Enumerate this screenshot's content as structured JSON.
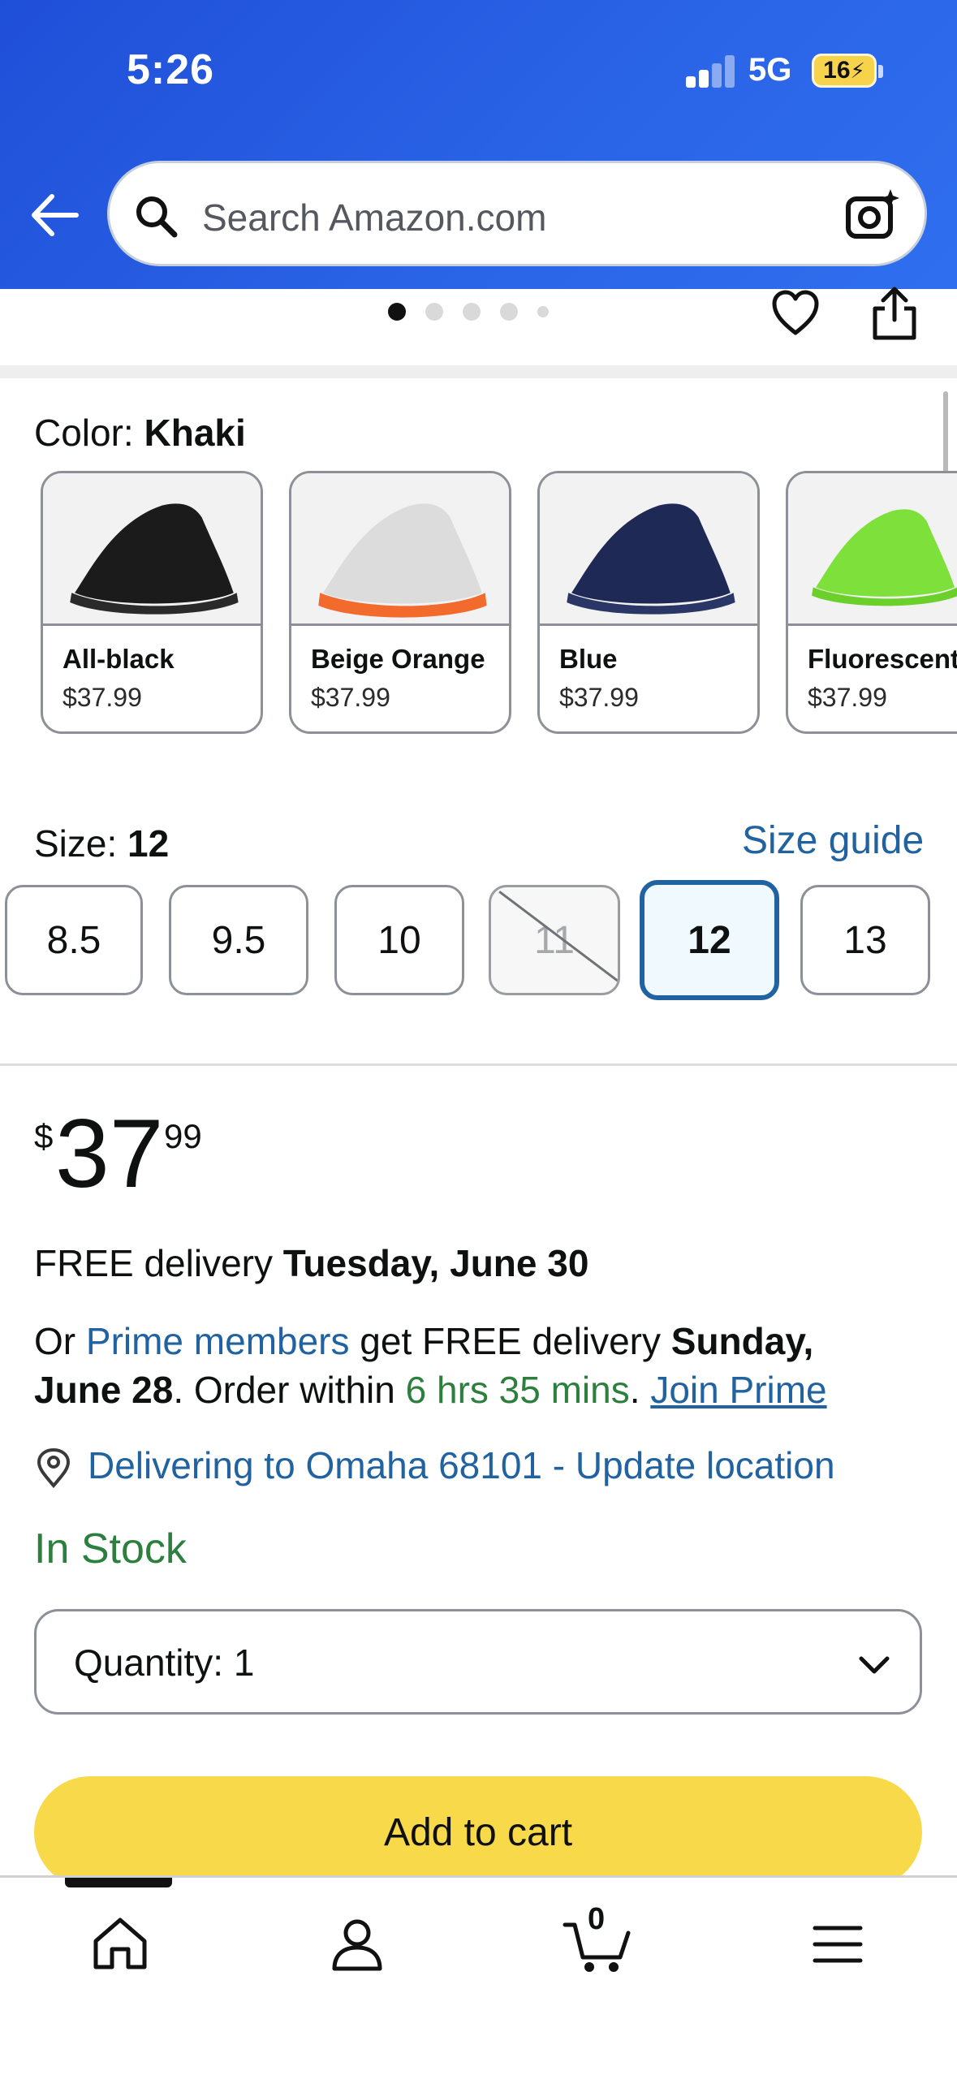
{
  "status_bar": {
    "time": "5:26",
    "network": "5G",
    "battery": "16"
  },
  "search": {
    "placeholder": "Search Amazon.com"
  },
  "gallery": {
    "dot_count": 5,
    "active_index": 0
  },
  "color": {
    "label": "Color:",
    "selected": "Khaki",
    "options": [
      {
        "name": "All-black",
        "price": "$37.99",
        "shoe_color": "#1b1b1b",
        "sole_color": "#2a2a2a"
      },
      {
        "name": "Beige Orange",
        "price": "$37.99",
        "shoe_color": "#dcdcdc",
        "sole_color": "#f26a2c"
      },
      {
        "name": "Blue",
        "price": "$37.99",
        "shoe_color": "#1e2a55",
        "sole_color": "#2a3666"
      },
      {
        "name": "Fluorescent",
        "price": "$37.99",
        "shoe_color": "#7ee03a",
        "sole_color": "#6bd12a"
      }
    ]
  },
  "size": {
    "label": "Size:",
    "selected": "12",
    "guide_link": "Size guide",
    "options": [
      {
        "value": "8.5",
        "state": "available"
      },
      {
        "value": "9.5",
        "state": "available"
      },
      {
        "value": "10",
        "state": "available"
      },
      {
        "value": "11",
        "state": "unavailable"
      },
      {
        "value": "12",
        "state": "selected"
      },
      {
        "value": "13",
        "state": "available"
      }
    ]
  },
  "price": {
    "symbol": "$",
    "whole": "37",
    "fraction": "99"
  },
  "delivery": {
    "free_prefix": "FREE delivery ",
    "free_date": "Tuesday, June 30",
    "prime_or": "Or ",
    "prime_members": "Prime members",
    "prime_mid": " get FREE delivery ",
    "prime_date_part1": "Sunday,",
    "prime_date_part2": "June 28",
    "order_within_prefix": ". Order within ",
    "order_within_time": "6 hrs 35 mins",
    "period": ". ",
    "join_prime": "Join Prime",
    "location": "Delivering to Omaha 68101 - Update location"
  },
  "stock": "In Stock",
  "quantity": {
    "label": "Quantity:",
    "value": "1"
  },
  "add_to_cart": "Add to cart",
  "bottom_nav": {
    "cart_count": "0"
  },
  "colors": {
    "header_blue": "#2a63e6",
    "link_blue": "#2162a1",
    "stock_green": "#2d7f3e",
    "cart_yellow": "#f8d94a"
  }
}
